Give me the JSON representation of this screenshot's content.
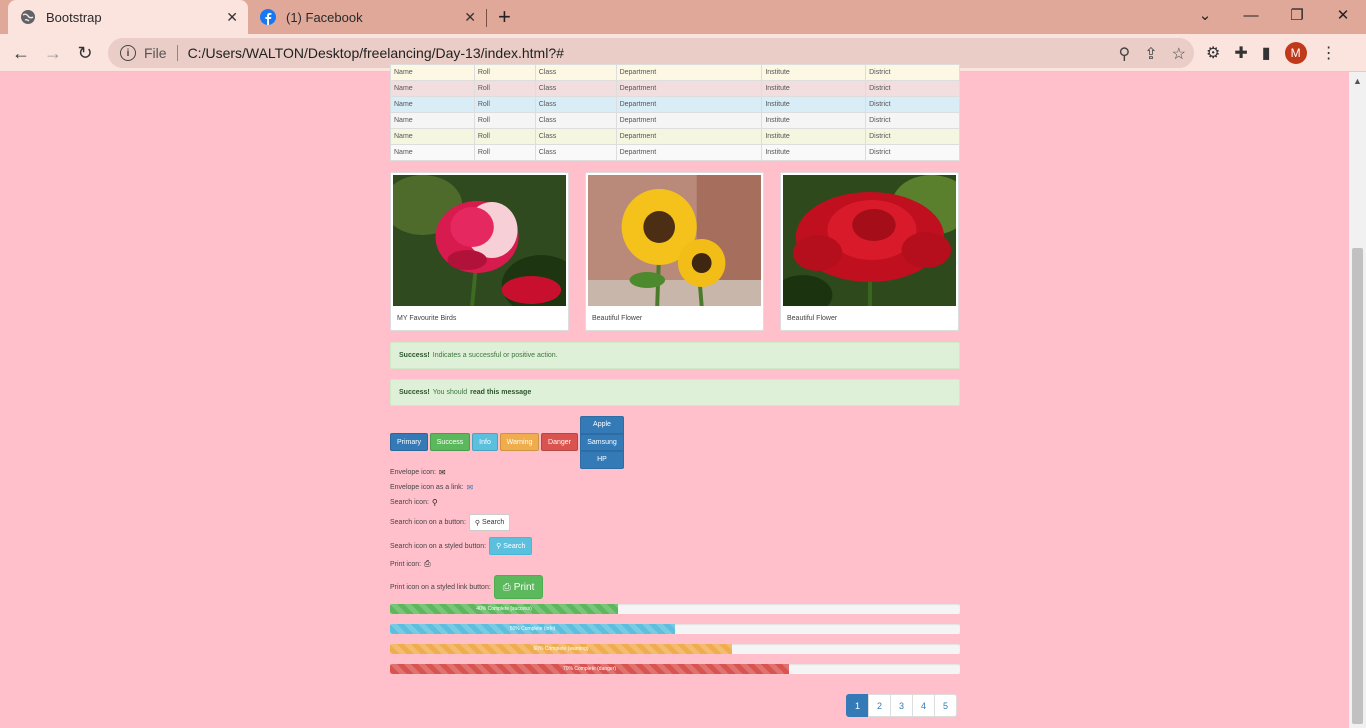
{
  "browser": {
    "tabs": [
      {
        "title": "Bootstrap",
        "active": true,
        "icon": "globe-icon"
      },
      {
        "title": "(1) Facebook",
        "active": false,
        "icon": "facebook-icon"
      }
    ],
    "address": {
      "scheme_label": "File",
      "url": "C:/Users/WALTON/Desktop/freelancing/Day-13/index.html?#"
    },
    "profile_initial": "M"
  },
  "table": {
    "rows": [
      {
        "variant": "warning",
        "cells": [
          "Name",
          "Roll",
          "Class",
          "Department",
          "Institute",
          "District"
        ]
      },
      {
        "variant": "danger",
        "cells": [
          "Name",
          "Roll",
          "Class",
          "Department",
          "Institute",
          "District"
        ]
      },
      {
        "variant": "info",
        "cells": [
          "Name",
          "Roll",
          "Class",
          "Department",
          "Institute",
          "District"
        ]
      },
      {
        "variant": "active",
        "cells": [
          "Name",
          "Roll",
          "Class",
          "Department",
          "Institute",
          "District"
        ]
      },
      {
        "variant": "warning2",
        "cells": [
          "Name",
          "Roll",
          "Class",
          "Department",
          "Institute",
          "District"
        ]
      },
      {
        "variant": "plain",
        "cells": [
          "Name",
          "Roll",
          "Class",
          "Department",
          "Institute",
          "District"
        ]
      }
    ]
  },
  "gallery": [
    {
      "caption": "MY Favourite Birds",
      "image": "pink-rose"
    },
    {
      "caption": "Beautiful Flower",
      "image": "sunflowers"
    },
    {
      "caption": "Beautiful Flower",
      "image": "red-rose"
    }
  ],
  "alerts": {
    "first": {
      "strong": "Success!",
      "text": "Indicates a successful or positive action."
    },
    "second": {
      "strong": "Success!",
      "text": "You should",
      "link": "read this message"
    }
  },
  "buttons": {
    "primary": "Primary",
    "success": "Success",
    "info": "Info",
    "warning": "Warning",
    "danger": "Danger",
    "vertical_group": [
      "Apple",
      "Samsung",
      "HP"
    ]
  },
  "icons": {
    "envelope": "Envelope icon:",
    "envelope_link": "Envelope icon as a link:",
    "search": "Search icon:",
    "search_button_label": "Search icon on a button:",
    "search_button": "Search",
    "search_styled_label": "Search icon on a styled button:",
    "search_styled_button": "Search",
    "print": "Print icon:",
    "print_link_label": "Print icon on a styled link button:",
    "print_button": "Print"
  },
  "progress": [
    {
      "label": "40% Complete (success)",
      "value": 40,
      "color": "#5cb85c"
    },
    {
      "label": "50% Complete (info)",
      "value": 50,
      "color": "#5bc0de"
    },
    {
      "label": "60% Complete (warning)",
      "value": 60,
      "color": "#f0ad4e"
    },
    {
      "label": "70% Complete (danger)",
      "value": 70,
      "color": "#d9534f"
    }
  ],
  "pagination": {
    "pages": [
      "1",
      "2",
      "3",
      "4",
      "5"
    ],
    "active": "1"
  }
}
